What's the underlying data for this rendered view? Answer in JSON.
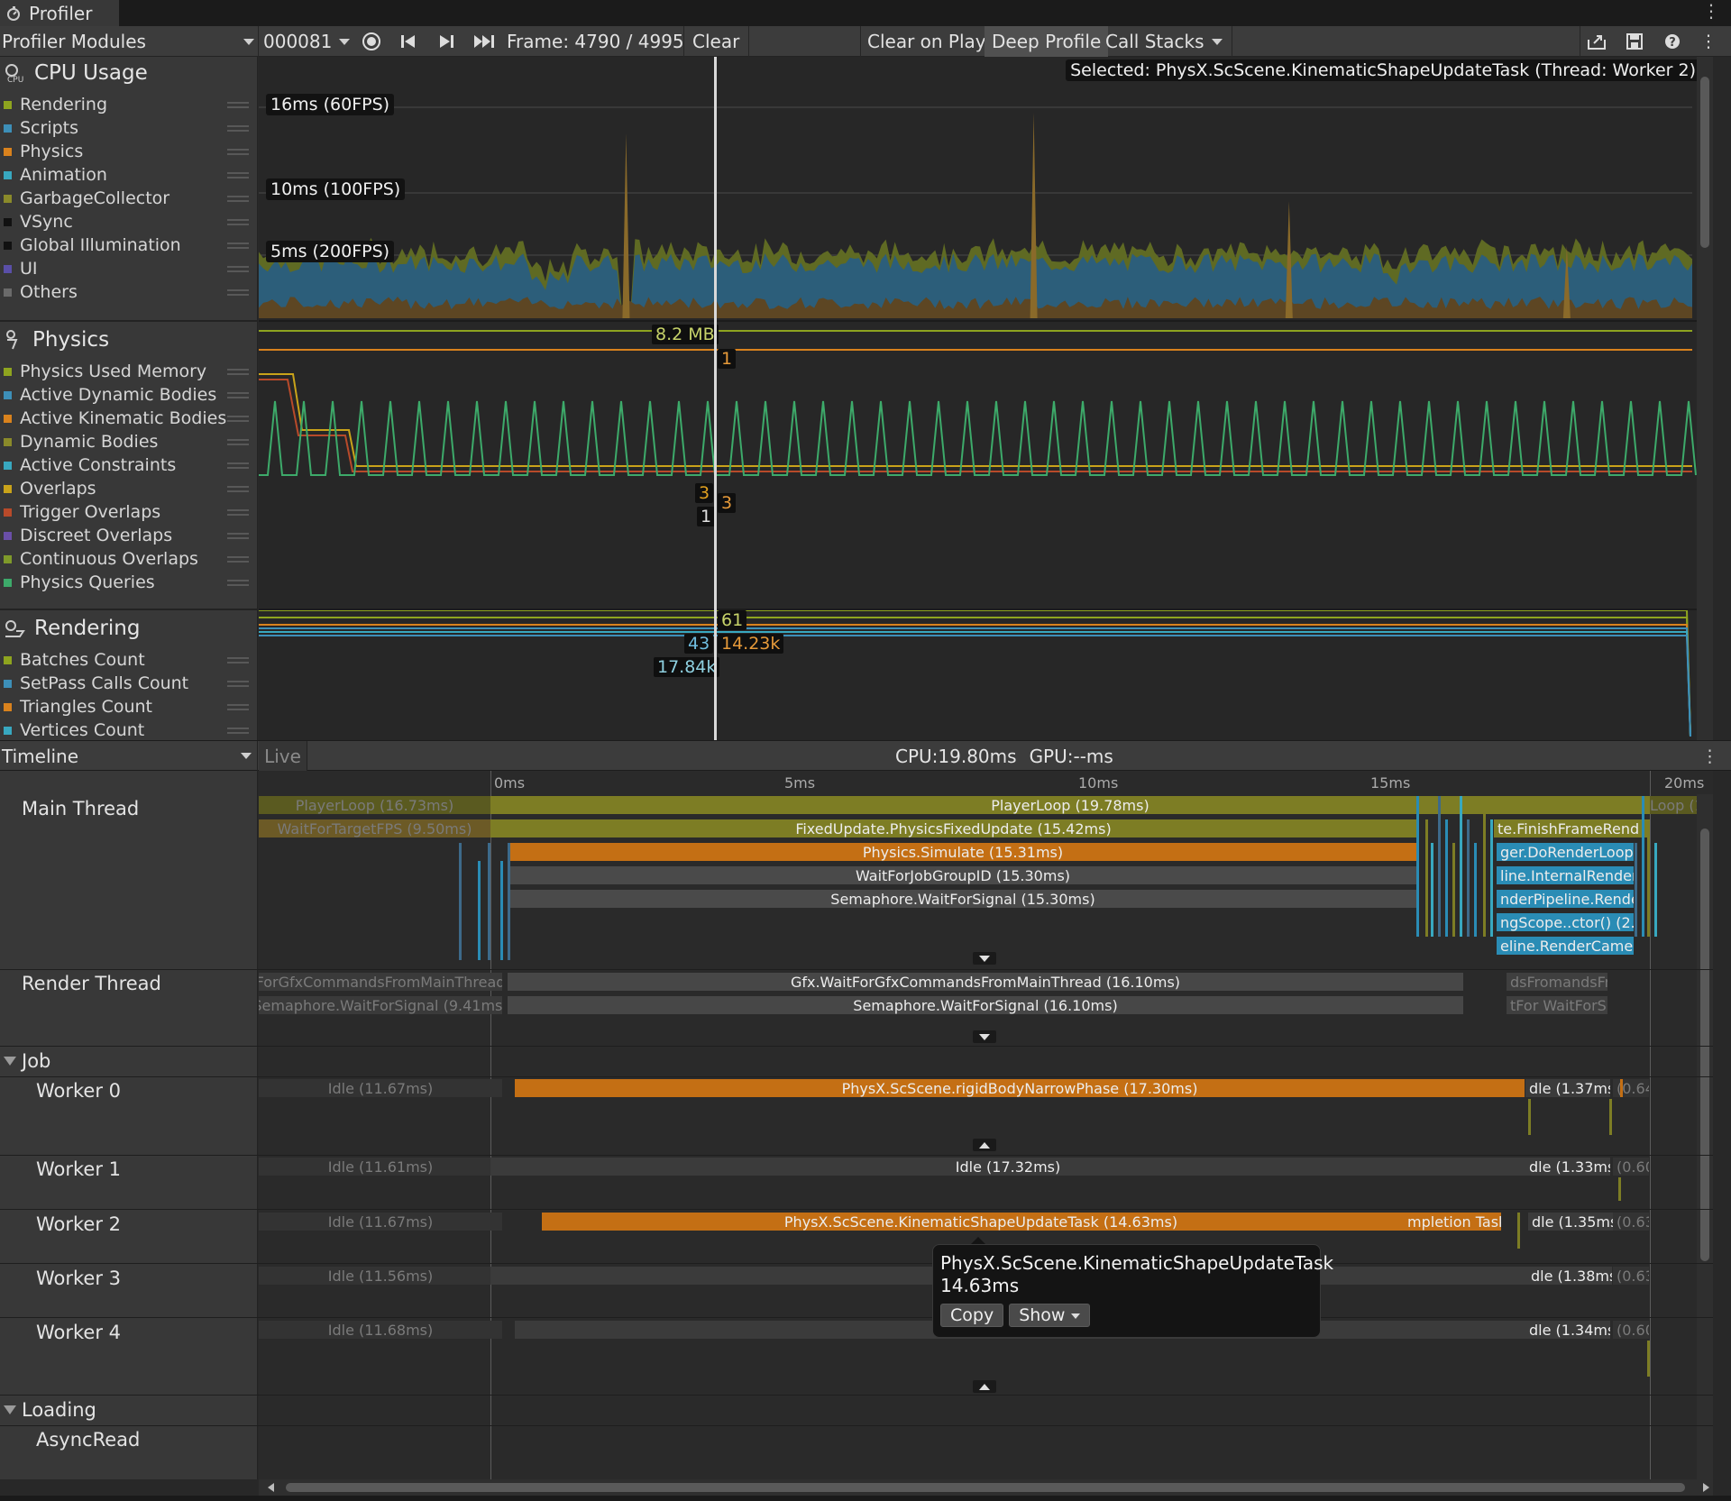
{
  "window": {
    "tab_title": "Profiler"
  },
  "toolbar": {
    "modules_dropdown": "Profiler Modules",
    "target": "000081",
    "frame": "Frame: 4790 / 4995",
    "clear": "Clear",
    "clear_on_play": "Clear on Play",
    "deep_profile": "Deep Profile",
    "call_stacks": "Call Stacks"
  },
  "cpu_module": {
    "title": "CPU Usage",
    "legend": [
      {
        "label": "Rendering",
        "color": "#8ea41f"
      },
      {
        "label": "Scripts",
        "color": "#3d8fb8"
      },
      {
        "label": "Physics",
        "color": "#d9821d"
      },
      {
        "label": "Animation",
        "color": "#38a8c0"
      },
      {
        "label": "GarbageCollector",
        "color": "#8a8a2a"
      },
      {
        "label": "VSync",
        "color": "#111111"
      },
      {
        "label": "Global Illumination",
        "color": "#111111"
      },
      {
        "label": "UI",
        "color": "#5a4fa8"
      },
      {
        "label": "Others",
        "color": "#6a6a6a"
      }
    ],
    "markers": [
      "16ms (60FPS)",
      "10ms (100FPS)",
      "5ms (200FPS)"
    ],
    "selected": "Selected: PhysX.ScScene.KinematicShapeUpdateTask (Thread: Worker 2)"
  },
  "physics_module": {
    "title": "Physics",
    "legend": [
      {
        "label": "Physics Used Memory",
        "color": "#8ea41f"
      },
      {
        "label": "Active Dynamic Bodies",
        "color": "#3d8fb8"
      },
      {
        "label": "Active Kinematic Bodies",
        "color": "#d9821d"
      },
      {
        "label": "Dynamic Bodies",
        "color": "#8a8a2a"
      },
      {
        "label": "Active Constraints",
        "color": "#38a8c0"
      },
      {
        "label": "Overlaps",
        "color": "#c9a31a"
      },
      {
        "label": "Trigger Overlaps",
        "color": "#b84a2a"
      },
      {
        "label": "Discreet Overlaps",
        "color": "#6a4fa8"
      },
      {
        "label": "Continuous Overlaps",
        "color": "#7f9a2a"
      },
      {
        "label": "Physics Queries",
        "color": "#3daa6a"
      }
    ],
    "values": [
      "8.2 MB",
      "1",
      "3",
      "3",
      "1"
    ]
  },
  "rendering_module": {
    "title": "Rendering",
    "legend": [
      {
        "label": "Batches Count",
        "color": "#8ea41f"
      },
      {
        "label": "SetPass Calls Count",
        "color": "#3d8fb8"
      },
      {
        "label": "Triangles Count",
        "color": "#d9821d"
      },
      {
        "label": "Vertices Count",
        "color": "#38a8c0"
      }
    ],
    "values": [
      "61",
      "43",
      "14.23k",
      "17.84k"
    ]
  },
  "timeline": {
    "dropdown": "Timeline",
    "live": "Live",
    "cpu": "CPU:19.80ms",
    "gpu": "GPU:--ms",
    "ruler": [
      "0ms",
      "5ms",
      "10ms",
      "15ms",
      "20ms"
    ],
    "threads": {
      "main": "Main Thread",
      "render": "Render Thread",
      "job": "Job",
      "worker0": "Worker 0",
      "worker1": "Worker 1",
      "worker2": "Worker 2",
      "worker3": "Worker 3",
      "worker4": "Worker 4",
      "loading": "Loading",
      "asyncread": "AsyncRead"
    },
    "main_bars": {
      "prev_playerloop": "PlayerLoop (16.73ms)",
      "prev_waitfps": "WaitForTargetFPS (9.50ms)",
      "playerloop": "PlayerLoop (19.78ms)",
      "next_playerloop": "Loop (12",
      "fixedupdate": "FixedUpdate.PhysicsFixedUpdate (15.42ms)",
      "finishframe": "te.FinishFrameRend",
      "simulate": "Physics.Simulate (15.31ms)",
      "dorender": "ger.DoRenderLoop",
      "waitjob": "WaitForJobGroupID (15.30ms)",
      "internalrender": "line.InternalRender",
      "semaphore": "Semaphore.WaitForSignal (15.30ms)",
      "renderpipe": "nderPipeline.Rende",
      "scopector": "ngScope..ctor() (2.",
      "rendercam": "eline.RenderCame"
    },
    "render_bars": {
      "prev_gfx": "ForGfxCommandsFromMainThread",
      "prev_sem": "Semaphore.WaitForSignal (9.41ms)",
      "gfx": "Gfx.WaitForGfxCommandsFromMainThread (16.10ms)",
      "sem": "Semaphore.WaitForSignal (16.10ms)",
      "tail1": "dsFromandsFrom",
      "tail2": "tFor WaitForSi"
    },
    "worker_bars": {
      "w0_idle": "Idle (11.67ms)",
      "w0_task": "PhysX.ScScene.rigidBodyNarrowPhase (17.30ms)",
      "w0_tail": "dle (1.37ms",
      "w0_tail2": "(0.64",
      "w1_idle": "Idle (11.61ms)",
      "w1_main": "Idle (17.32ms)",
      "w1_tail": "dle (1.33ms",
      "w1_tail2": "(0.60",
      "w2_idle": "Idle (11.67ms)",
      "w2_task": "PhysX.ScScene.KinematicShapeUpdateTask (14.63ms)",
      "w2_completion": "mpletion Task",
      "w2_tail": "dle (1.35ms",
      "w2_tail2": "(0.63",
      "w3_idle": "Idle (11.56ms)",
      "w3_tail": "dle (1.38ms",
      "w3_tail2": "(0.63",
      "w4_idle": "Idle (11.68ms)",
      "w4_tail": "dle (1.34ms",
      "w4_tail2": "(0.60"
    },
    "tooltip": {
      "name": "PhysX.ScScene.KinematicShapeUpdateTask",
      "duration": "14.63ms",
      "copy": "Copy",
      "show": "Show"
    }
  }
}
